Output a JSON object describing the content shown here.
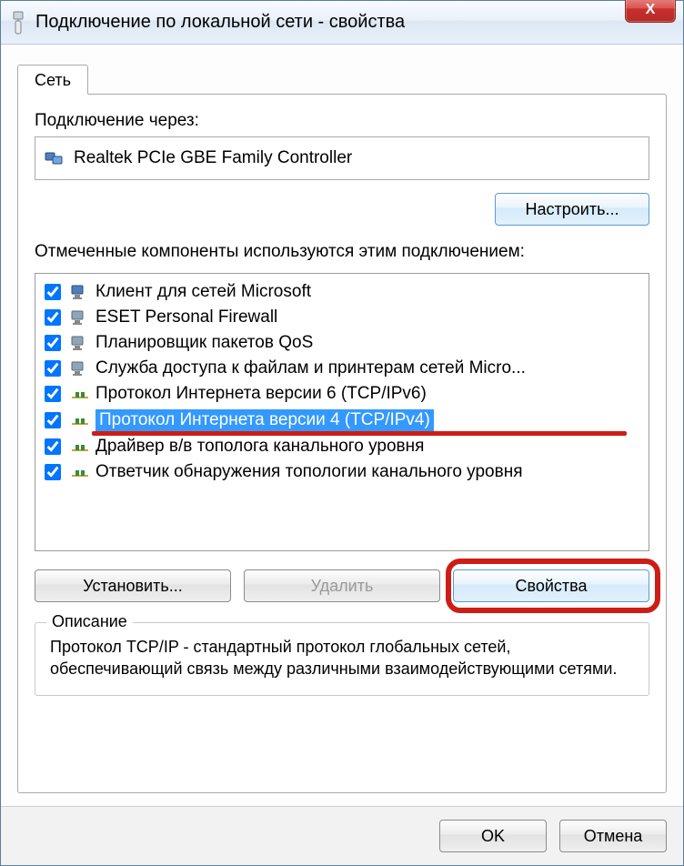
{
  "title": "Подключение по локальной сети - свойства",
  "close": "X",
  "tab": {
    "label": "Сеть"
  },
  "connect_using_label": "Подключение через:",
  "adapter": {
    "name": "Realtek PCIe GBE Family Controller"
  },
  "configure_btn": "Настроить...",
  "components_label": "Отмеченные компоненты используются этим подключением:",
  "components": [
    {
      "label": "Клиент для сетей Microsoft",
      "icon": "client",
      "checked": true,
      "selected": false
    },
    {
      "label": "ESET Personal Firewall",
      "icon": "service",
      "checked": true,
      "selected": false
    },
    {
      "label": "Планировщик пакетов QoS",
      "icon": "service",
      "checked": true,
      "selected": false
    },
    {
      "label": "Служба доступа к файлам и принтерам сетей Micro...",
      "icon": "service",
      "checked": true,
      "selected": false
    },
    {
      "label": "Протокол Интернета версии 6 (TCP/IPv6)",
      "icon": "protocol",
      "checked": true,
      "selected": false
    },
    {
      "label": "Протокол Интернета версии 4 (TCP/IPv4)",
      "icon": "protocol",
      "checked": true,
      "selected": true
    },
    {
      "label": "Драйвер в/в тополога канального уровня",
      "icon": "protocol",
      "checked": true,
      "selected": false
    },
    {
      "label": "Ответчик обнаружения топологии канального уровня",
      "icon": "protocol",
      "checked": true,
      "selected": false
    }
  ],
  "buttons": {
    "install": "Установить...",
    "uninstall": "Удалить",
    "properties": "Свойства"
  },
  "description": {
    "legend": "Описание",
    "text": "Протокол TCP/IP - стандартный протокол глобальных сетей, обеспечивающий связь между различными взаимодействующими сетями."
  },
  "footer": {
    "ok": "OK",
    "cancel": "Отмена"
  }
}
